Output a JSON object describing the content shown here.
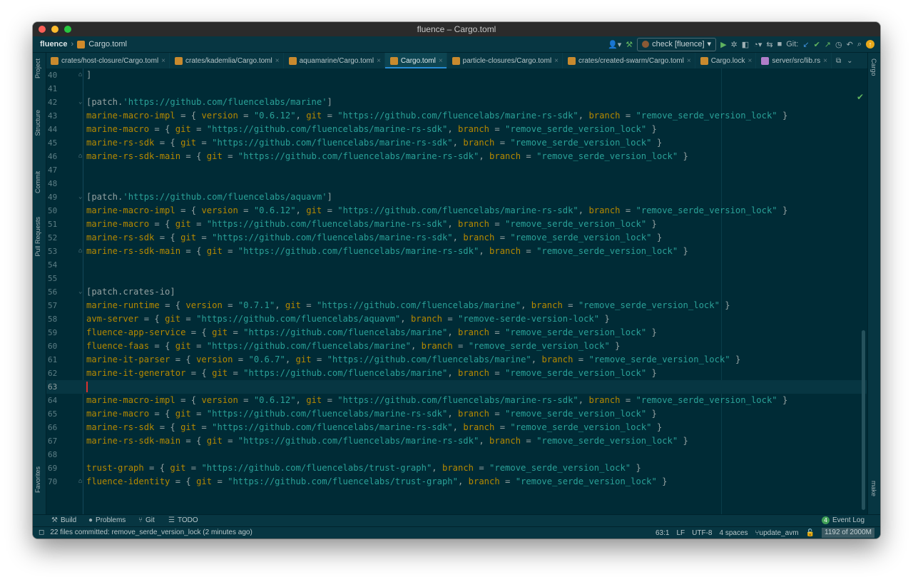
{
  "window": {
    "title": "fluence – Cargo.toml"
  },
  "navbar": {
    "project": "fluence",
    "separator": "›",
    "file": "Cargo.toml",
    "run_config": "check [fluence]",
    "git_label": "Git:"
  },
  "tabs": [
    {
      "label": "crates/host-closure/Cargo.toml",
      "active": false,
      "icon": "cargo-icon"
    },
    {
      "label": "crates/kademlia/Cargo.toml",
      "active": false,
      "icon": "cargo-icon"
    },
    {
      "label": "aquamarine/Cargo.toml",
      "active": false,
      "icon": "cargo-icon"
    },
    {
      "label": "Cargo.toml",
      "active": true,
      "icon": "cargo-icon"
    },
    {
      "label": "particle-closures/Cargo.toml",
      "active": false,
      "icon": "cargo-icon"
    },
    {
      "label": "crates/created-swarm/Cargo.toml",
      "active": false,
      "icon": "cargo-icon"
    },
    {
      "label": "Cargo.lock",
      "active": false,
      "icon": "cargo-icon"
    },
    {
      "label": "server/src/lib.rs",
      "active": false,
      "icon": "rust-icon"
    }
  ],
  "left_strip": [
    "Project",
    "Structure",
    "Commit",
    "Pull Requests",
    "Favorites"
  ],
  "right_strip": [
    "Cargo",
    "make"
  ],
  "editor": {
    "current_line": 63,
    "lines": [
      {
        "n": "40",
        "fold": "⌂",
        "t": [
          [
            "p",
            "]"
          ]
        ]
      },
      {
        "n": "41",
        "t": []
      },
      {
        "n": "42",
        "fold": "⌄",
        "t": [
          [
            "p",
            "[patch."
          ],
          [
            "s",
            "'https://github.com/fluencelabs/marine'"
          ],
          [
            "p",
            "]"
          ]
        ]
      },
      {
        "n": "43",
        "t": [
          [
            "k",
            "marine-macro-impl"
          ],
          [
            "p",
            " = { "
          ],
          [
            "k",
            "version"
          ],
          [
            "p",
            " = "
          ],
          [
            "s",
            "\"0.6.12\""
          ],
          [
            "p",
            ", "
          ],
          [
            "k",
            "git"
          ],
          [
            "p",
            " = "
          ],
          [
            "s",
            "\"https://github.com/fluencelabs/marine-rs-sdk\""
          ],
          [
            "p",
            ", "
          ],
          [
            "k",
            "branch"
          ],
          [
            "p",
            " = "
          ],
          [
            "s",
            "\"remove_serde_version_lock\""
          ],
          [
            "p",
            " }"
          ]
        ]
      },
      {
        "n": "44",
        "t": [
          [
            "k",
            "marine-macro"
          ],
          [
            "p",
            " = { "
          ],
          [
            "k",
            "git"
          ],
          [
            "p",
            " = "
          ],
          [
            "s",
            "\"https://github.com/fluencelabs/marine-rs-sdk\""
          ],
          [
            "p",
            ", "
          ],
          [
            "k",
            "branch"
          ],
          [
            "p",
            " = "
          ],
          [
            "s",
            "\"remove_serde_version_lock\""
          ],
          [
            "p",
            " }"
          ]
        ]
      },
      {
        "n": "45",
        "t": [
          [
            "k",
            "marine-rs-sdk"
          ],
          [
            "p",
            " = { "
          ],
          [
            "k",
            "git"
          ],
          [
            "p",
            " = "
          ],
          [
            "s",
            "\"https://github.com/fluencelabs/marine-rs-sdk\""
          ],
          [
            "p",
            ", "
          ],
          [
            "k",
            "branch"
          ],
          [
            "p",
            " = "
          ],
          [
            "s",
            "\"remove_serde_version_lock\""
          ],
          [
            "p",
            " }"
          ]
        ]
      },
      {
        "n": "46",
        "fold": "⌂",
        "t": [
          [
            "k",
            "marine-rs-sdk-main"
          ],
          [
            "p",
            " = { "
          ],
          [
            "k",
            "git"
          ],
          [
            "p",
            " = "
          ],
          [
            "s",
            "\"https://github.com/fluencelabs/marine-rs-sdk\""
          ],
          [
            "p",
            ", "
          ],
          [
            "k",
            "branch"
          ],
          [
            "p",
            " = "
          ],
          [
            "s",
            "\"remove_serde_version_lock\""
          ],
          [
            "p",
            " }"
          ]
        ]
      },
      {
        "n": "47",
        "t": []
      },
      {
        "n": "48",
        "t": []
      },
      {
        "n": "49",
        "fold": "⌄",
        "t": [
          [
            "p",
            "[patch."
          ],
          [
            "s",
            "'https://github.com/fluencelabs/aquavm'"
          ],
          [
            "p",
            "]"
          ]
        ]
      },
      {
        "n": "50",
        "t": [
          [
            "k",
            "marine-macro-impl"
          ],
          [
            "p",
            " = { "
          ],
          [
            "k",
            "version"
          ],
          [
            "p",
            " = "
          ],
          [
            "s",
            "\"0.6.12\""
          ],
          [
            "p",
            ", "
          ],
          [
            "k",
            "git"
          ],
          [
            "p",
            " = "
          ],
          [
            "s",
            "\"https://github.com/fluencelabs/marine-rs-sdk\""
          ],
          [
            "p",
            ", "
          ],
          [
            "k",
            "branch"
          ],
          [
            "p",
            " = "
          ],
          [
            "s",
            "\"remove_serde_version_lock\""
          ],
          [
            "p",
            " }"
          ]
        ]
      },
      {
        "n": "51",
        "t": [
          [
            "k",
            "marine-macro"
          ],
          [
            "p",
            " = { "
          ],
          [
            "k",
            "git"
          ],
          [
            "p",
            " = "
          ],
          [
            "s",
            "\"https://github.com/fluencelabs/marine-rs-sdk\""
          ],
          [
            "p",
            ", "
          ],
          [
            "k",
            "branch"
          ],
          [
            "p",
            " = "
          ],
          [
            "s",
            "\"remove_serde_version_lock\""
          ],
          [
            "p",
            " }"
          ]
        ]
      },
      {
        "n": "52",
        "t": [
          [
            "k",
            "marine-rs-sdk"
          ],
          [
            "p",
            " = { "
          ],
          [
            "k",
            "git"
          ],
          [
            "p",
            " = "
          ],
          [
            "s",
            "\"https://github.com/fluencelabs/marine-rs-sdk\""
          ],
          [
            "p",
            ", "
          ],
          [
            "k",
            "branch"
          ],
          [
            "p",
            " = "
          ],
          [
            "s",
            "\"remove_serde_version_lock\""
          ],
          [
            "p",
            " }"
          ]
        ]
      },
      {
        "n": "53",
        "fold": "⌂",
        "t": [
          [
            "k",
            "marine-rs-sdk-main"
          ],
          [
            "p",
            " = { "
          ],
          [
            "k",
            "git"
          ],
          [
            "p",
            " = "
          ],
          [
            "s",
            "\"https://github.com/fluencelabs/marine-rs-sdk\""
          ],
          [
            "p",
            ", "
          ],
          [
            "k",
            "branch"
          ],
          [
            "p",
            " = "
          ],
          [
            "s",
            "\"remove_serde_version_lock\""
          ],
          [
            "p",
            " }"
          ]
        ]
      },
      {
        "n": "54",
        "t": []
      },
      {
        "n": "55",
        "t": []
      },
      {
        "n": "56",
        "fold": "⌄",
        "t": [
          [
            "p",
            "[patch.crates-io]"
          ]
        ]
      },
      {
        "n": "57",
        "t": [
          [
            "k",
            "marine-runtime"
          ],
          [
            "p",
            " = { "
          ],
          [
            "k",
            "version"
          ],
          [
            "p",
            " = "
          ],
          [
            "s",
            "\"0.7.1\""
          ],
          [
            "p",
            ", "
          ],
          [
            "k",
            "git"
          ],
          [
            "p",
            " = "
          ],
          [
            "s",
            "\"https://github.com/fluencelabs/marine\""
          ],
          [
            "p",
            ", "
          ],
          [
            "k",
            "branch"
          ],
          [
            "p",
            " = "
          ],
          [
            "s",
            "\"remove_serde_version_lock\""
          ],
          [
            "p",
            " }"
          ]
        ]
      },
      {
        "n": "58",
        "t": [
          [
            "k",
            "avm-server"
          ],
          [
            "p",
            " = { "
          ],
          [
            "k",
            "git"
          ],
          [
            "p",
            " = "
          ],
          [
            "s",
            "\"https://github.com/fluencelabs/aquavm\""
          ],
          [
            "p",
            ", "
          ],
          [
            "k",
            "branch"
          ],
          [
            "p",
            " = "
          ],
          [
            "s",
            "\"remove-serde-version-lock\""
          ],
          [
            "p",
            " }"
          ]
        ]
      },
      {
        "n": "59",
        "t": [
          [
            "k",
            "fluence-app-service"
          ],
          [
            "p",
            " = { "
          ],
          [
            "k",
            "git"
          ],
          [
            "p",
            " = "
          ],
          [
            "s",
            "\"https://github.com/fluencelabs/marine\""
          ],
          [
            "p",
            ", "
          ],
          [
            "k",
            "branch"
          ],
          [
            "p",
            " = "
          ],
          [
            "s",
            "\"remove_serde_version_lock\""
          ],
          [
            "p",
            " }"
          ]
        ]
      },
      {
        "n": "60",
        "t": [
          [
            "k",
            "fluence-faas"
          ],
          [
            "p",
            " = { "
          ],
          [
            "k",
            "git"
          ],
          [
            "p",
            " = "
          ],
          [
            "s",
            "\"https://github.com/fluencelabs/marine\""
          ],
          [
            "p",
            ", "
          ],
          [
            "k",
            "branch"
          ],
          [
            "p",
            " = "
          ],
          [
            "s",
            "\"remove_serde_version_lock\""
          ],
          [
            "p",
            " }"
          ]
        ]
      },
      {
        "n": "61",
        "t": [
          [
            "k",
            "marine-it-parser"
          ],
          [
            "p",
            " = { "
          ],
          [
            "k",
            "version"
          ],
          [
            "p",
            " = "
          ],
          [
            "s",
            "\"0.6.7\""
          ],
          [
            "p",
            ", "
          ],
          [
            "k",
            "git"
          ],
          [
            "p",
            " = "
          ],
          [
            "s",
            "\"https://github.com/fluencelabs/marine\""
          ],
          [
            "p",
            ", "
          ],
          [
            "k",
            "branch"
          ],
          [
            "p",
            " = "
          ],
          [
            "s",
            "\"remove_serde_version_lock\""
          ],
          [
            "p",
            " }"
          ]
        ]
      },
      {
        "n": "62",
        "t": [
          [
            "k",
            "marine-it-generator"
          ],
          [
            "p",
            " = { "
          ],
          [
            "k",
            "git"
          ],
          [
            "p",
            " = "
          ],
          [
            "s",
            "\"https://github.com/fluencelabs/marine\""
          ],
          [
            "p",
            ", "
          ],
          [
            "k",
            "branch"
          ],
          [
            "p",
            " = "
          ],
          [
            "s",
            "\"remove_serde_version_lock\""
          ],
          [
            "p",
            " }"
          ]
        ]
      },
      {
        "n": "63",
        "caret": true,
        "t": []
      },
      {
        "n": "64",
        "t": [
          [
            "k",
            "marine-macro-impl"
          ],
          [
            "p",
            " = { "
          ],
          [
            "k",
            "version"
          ],
          [
            "p",
            " = "
          ],
          [
            "s",
            "\"0.6.12\""
          ],
          [
            "p",
            ", "
          ],
          [
            "k",
            "git"
          ],
          [
            "p",
            " = "
          ],
          [
            "s",
            "\"https://github.com/fluencelabs/marine-rs-sdk\""
          ],
          [
            "p",
            ", "
          ],
          [
            "k",
            "branch"
          ],
          [
            "p",
            " = "
          ],
          [
            "s",
            "\"remove_serde_version_lock\""
          ],
          [
            "p",
            " }"
          ]
        ]
      },
      {
        "n": "65",
        "t": [
          [
            "k",
            "marine-macro"
          ],
          [
            "p",
            " = { "
          ],
          [
            "k",
            "git"
          ],
          [
            "p",
            " = "
          ],
          [
            "s",
            "\"https://github.com/fluencelabs/marine-rs-sdk\""
          ],
          [
            "p",
            ", "
          ],
          [
            "k",
            "branch"
          ],
          [
            "p",
            " = "
          ],
          [
            "s",
            "\"remove_serde_version_lock\""
          ],
          [
            "p",
            " }"
          ]
        ]
      },
      {
        "n": "66",
        "t": [
          [
            "k",
            "marine-rs-sdk"
          ],
          [
            "p",
            " = { "
          ],
          [
            "k",
            "git"
          ],
          [
            "p",
            " = "
          ],
          [
            "s",
            "\"https://github.com/fluencelabs/marine-rs-sdk\""
          ],
          [
            "p",
            ", "
          ],
          [
            "k",
            "branch"
          ],
          [
            "p",
            " = "
          ],
          [
            "s",
            "\"remove_serde_version_lock\""
          ],
          [
            "p",
            " }"
          ]
        ]
      },
      {
        "n": "67",
        "t": [
          [
            "k",
            "marine-rs-sdk-main"
          ],
          [
            "p",
            " = { "
          ],
          [
            "k",
            "git"
          ],
          [
            "p",
            " = "
          ],
          [
            "s",
            "\"https://github.com/fluencelabs/marine-rs-sdk\""
          ],
          [
            "p",
            ", "
          ],
          [
            "k",
            "branch"
          ],
          [
            "p",
            " = "
          ],
          [
            "s",
            "\"remove_serde_version_lock\""
          ],
          [
            "p",
            " }"
          ]
        ]
      },
      {
        "n": "68",
        "t": []
      },
      {
        "n": "69",
        "t": [
          [
            "k",
            "trust-graph"
          ],
          [
            "p",
            " = { "
          ],
          [
            "k",
            "git"
          ],
          [
            "p",
            " = "
          ],
          [
            "s",
            "\"https://github.com/fluencelabs/trust-graph\""
          ],
          [
            "p",
            ", "
          ],
          [
            "k",
            "branch"
          ],
          [
            "p",
            " = "
          ],
          [
            "s",
            "\"remove_serde_version_lock\""
          ],
          [
            "p",
            " }"
          ]
        ]
      },
      {
        "n": "70",
        "fold": "⌂",
        "t": [
          [
            "k",
            "fluence-identity"
          ],
          [
            "p",
            " = { "
          ],
          [
            "k",
            "git"
          ],
          [
            "p",
            " = "
          ],
          [
            "s",
            "\"https://github.com/fluencelabs/trust-graph\""
          ],
          [
            "p",
            ", "
          ],
          [
            "k",
            "branch"
          ],
          [
            "p",
            " = "
          ],
          [
            "s",
            "\"remove_serde_version_lock\""
          ],
          [
            "p",
            " }"
          ]
        ]
      }
    ]
  },
  "toolwindows": {
    "build": "Build",
    "problems": "Problems",
    "git": "Git",
    "todo": "TODO",
    "event_count": "4",
    "event_log": "Event Log"
  },
  "status": {
    "message": "22 files committed: remove_serde_version_lock (2 minutes ago)",
    "position": "63:1",
    "line_sep": "LF",
    "encoding": "UTF-8",
    "indent": "4 spaces",
    "branch": "update_avm",
    "memory": "1192 of 2000M"
  },
  "colors": {
    "editor_bg": "#002b36",
    "key": "#b58900",
    "string": "#2aa198",
    "plain": "#93a1a1",
    "accent": "#268bd2"
  }
}
